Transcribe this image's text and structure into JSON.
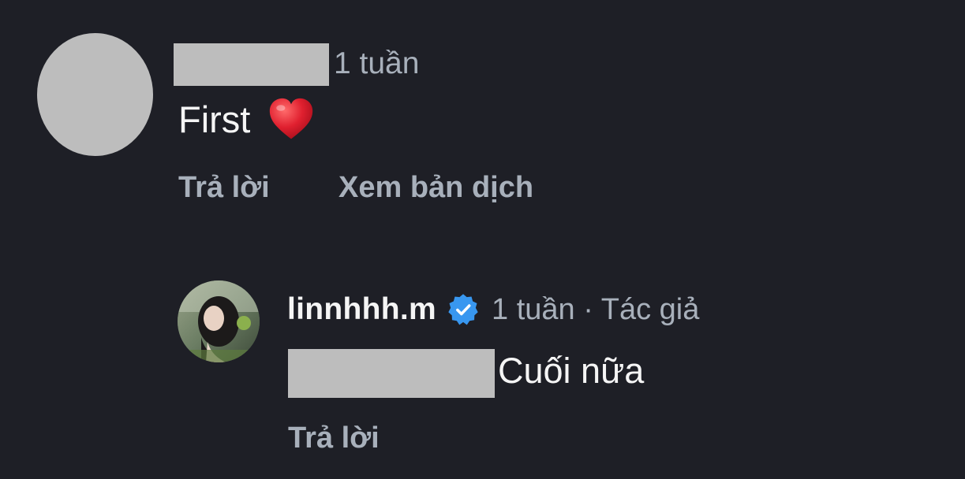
{
  "comment_1": {
    "time": "1 tuần",
    "text": "First",
    "emoji": "heart-emoji",
    "reply_label": "Trả lời",
    "translate_label": "Xem bản dịch"
  },
  "comment_2": {
    "username": "linnhhh.m",
    "time_meta": "1 tuần · Tác giả",
    "text": "Cuối nữa",
    "reply_label": "Trả lời"
  },
  "colors": {
    "background": "#1e1f26",
    "muted_text": "#a8b0bb",
    "primary_text": "#f5f5f5",
    "redaction": "#bdbdbd",
    "verified_badge": "#3897f0",
    "heart": "#e0202f"
  }
}
